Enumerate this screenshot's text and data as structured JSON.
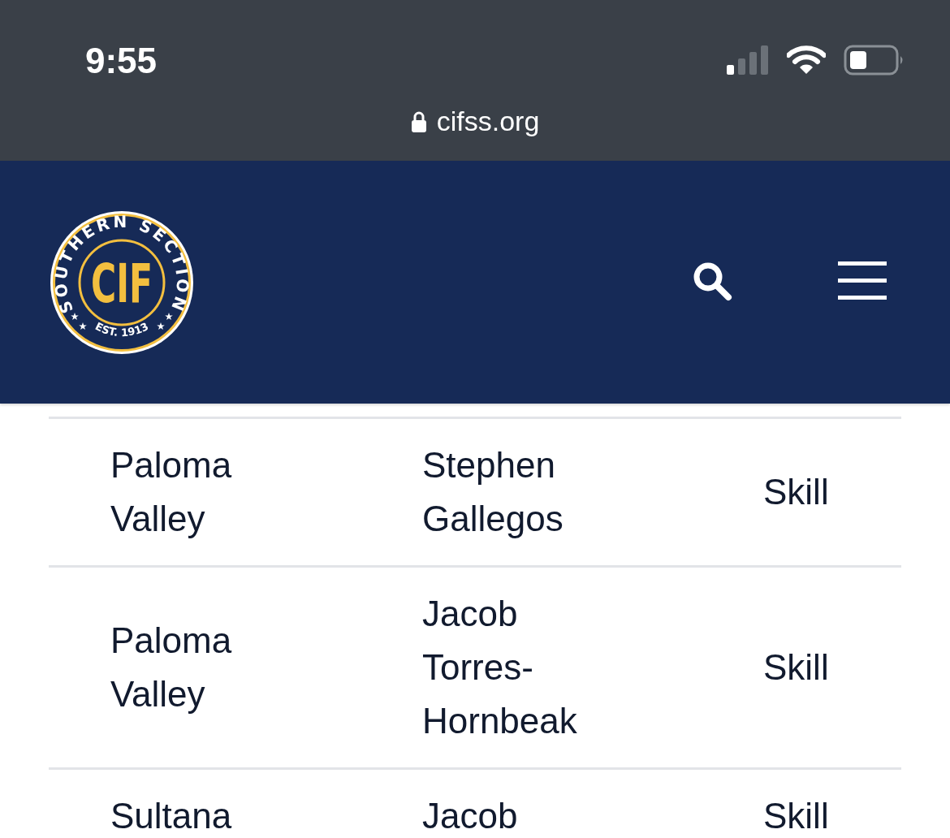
{
  "status_bar": {
    "time": "9:55",
    "url": "cifss.org"
  },
  "header": {
    "logo": {
      "ring_text": "SOUTHERN SECTION",
      "monogram": "CIF",
      "established": "EST. 1913"
    }
  },
  "table": {
    "rows": [
      {
        "cells": [
          "Paloma Valley",
          "Stephen Gallegos",
          "Skill"
        ]
      },
      {
        "cells": [
          "Paloma Valley",
          "Jacob Torres-Hornbeak",
          "Skill"
        ]
      },
      {
        "cells": [
          "Sultana",
          "Jacob",
          "Skill"
        ]
      }
    ]
  }
}
